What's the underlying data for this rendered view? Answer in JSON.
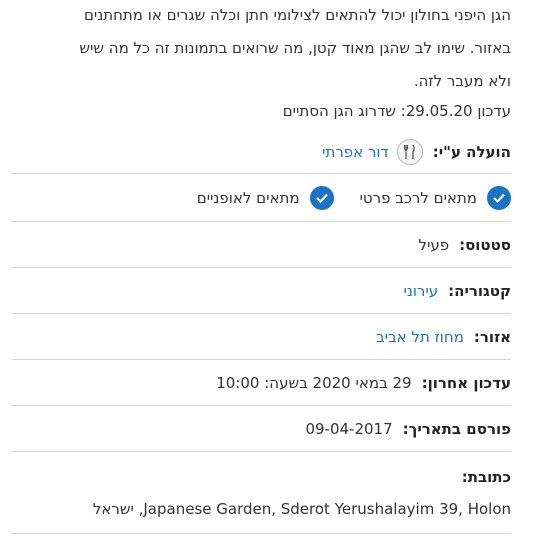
{
  "description_lines": [
    "הגן היפני בחולון יכול להתאים לצילומי חתן וכלה שגרים או מתחתנים",
    "באזור. שימו לב שהגן מאוד קטן, מה שרואים בתמונות זה כל מה שיש",
    "ולא מעבר לזה."
  ],
  "update_note": "עדכון 29.05.20: שדרוג הגן הסתיים",
  "uploader": {
    "label": "הועלה ע\"י:",
    "name": "דור אפרתי",
    "icon": "avatar-fork-knife-icon"
  },
  "suitability": [
    {
      "label": "מתאים לרכב פרטי",
      "icon": "check-circle-icon"
    },
    {
      "label": "מתאים לאופניים",
      "icon": "check-circle-icon"
    }
  ],
  "status": {
    "label": "סטטוס:",
    "value": "פעיל"
  },
  "category": {
    "label": "קטגוריה:",
    "value": "עירוני"
  },
  "area": {
    "label": "אזור:",
    "value": "מחוז תל אביב"
  },
  "last_update": {
    "label": "עדכון אחרון:",
    "value": "29 במאי 2020 בשעה: 10:00"
  },
  "published": {
    "label": "פורסם בתאריך:",
    "value": "09-04-2017"
  },
  "address": {
    "label": "כתובת:",
    "value": "Japanese Garden, Sderot Yerushalayim 39, Holon, ישראל"
  },
  "colors": {
    "accent": "#1a73c4",
    "divider": "#d6d6d6",
    "text": "#333333"
  }
}
